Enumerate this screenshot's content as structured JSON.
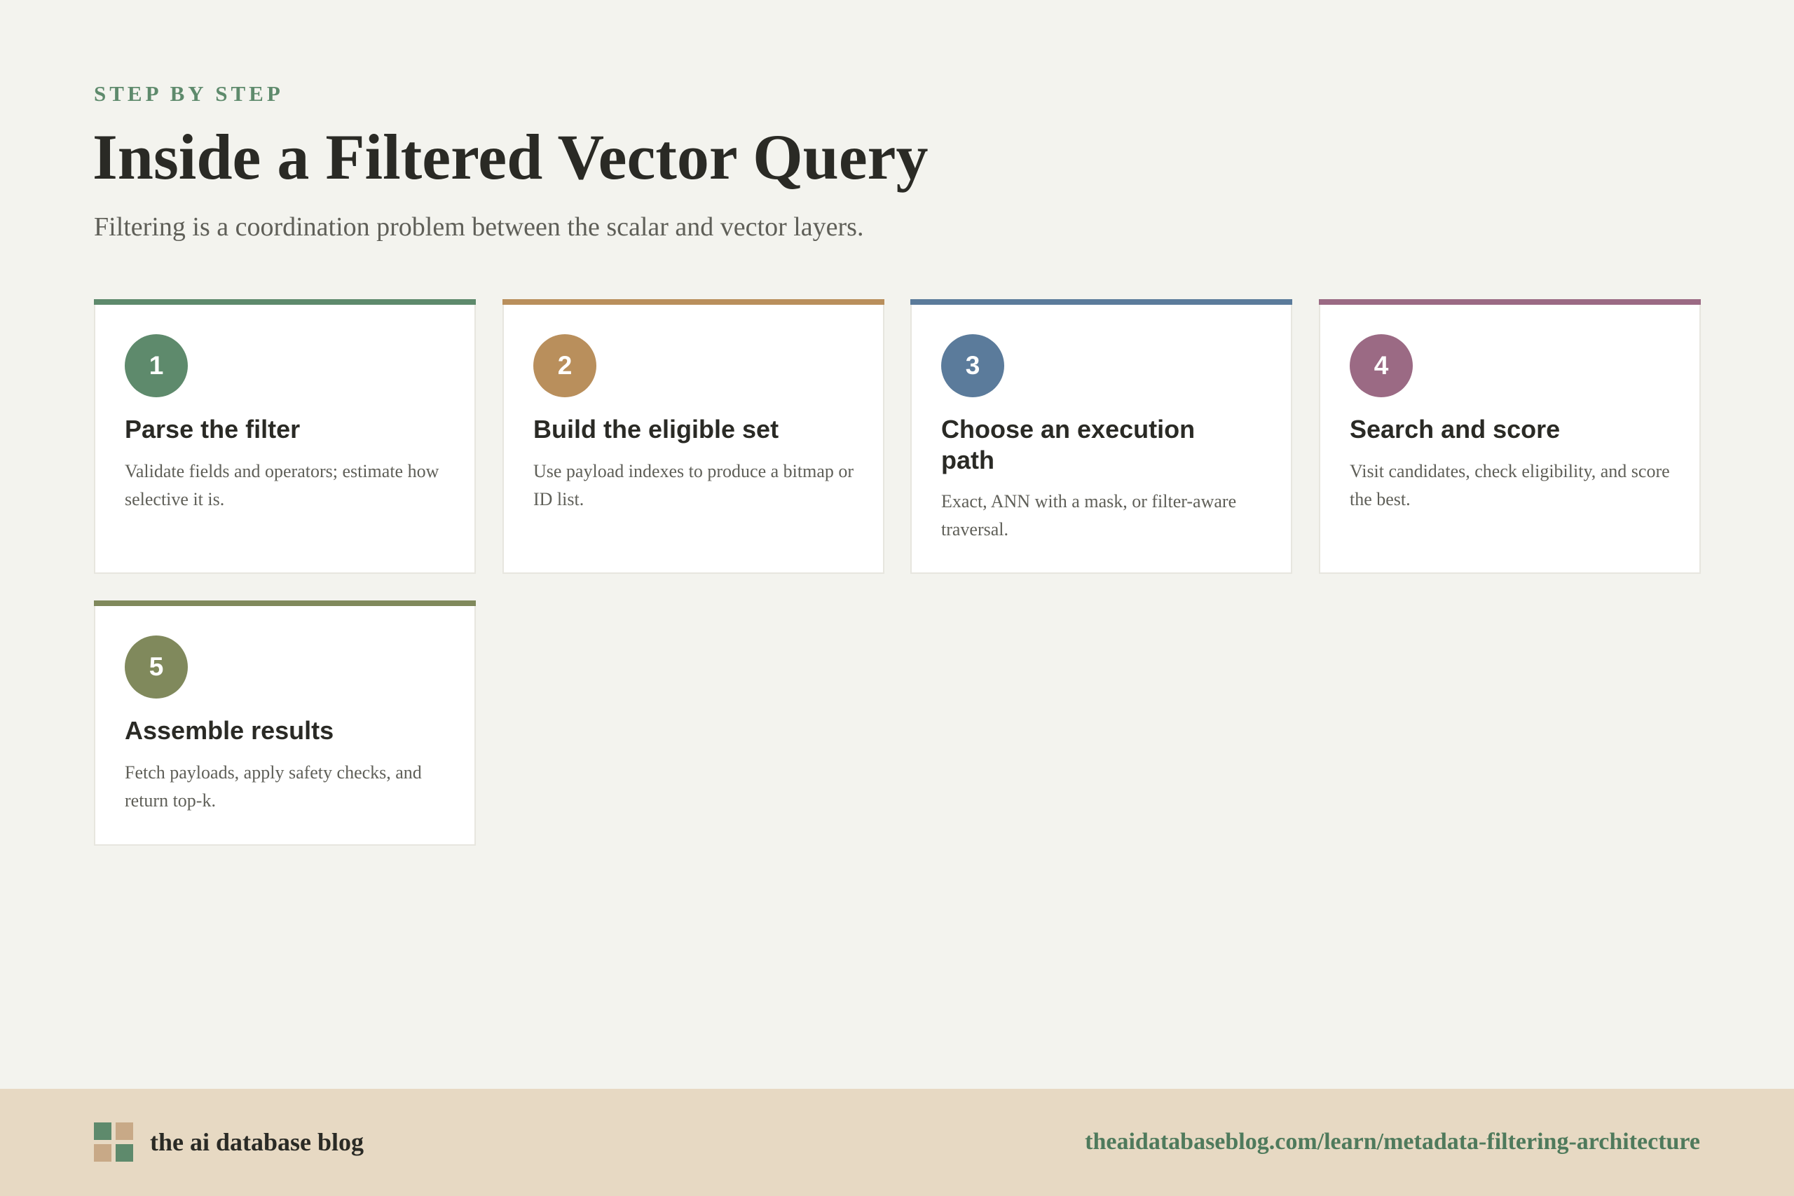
{
  "header": {
    "eyebrow": "STEP BY STEP",
    "title": "Inside a Filtered Vector Query",
    "subtitle": "Filtering is a coordination problem between the scalar and vector layers."
  },
  "steps": [
    {
      "number": "1",
      "title": "Parse the filter",
      "description": "Validate fields and operators; estimate how selective it is.",
      "color": "#5e8a6c"
    },
    {
      "number": "2",
      "title": "Build the eligible set",
      "description": "Use payload indexes to produce a bitmap or ID list.",
      "color": "#b98f5c"
    },
    {
      "number": "3",
      "title": "Choose an execution path",
      "description": "Exact, ANN with a mask, or filter-aware traversal.",
      "color": "#5b7b9b"
    },
    {
      "number": "4",
      "title": "Search and score",
      "description": "Visit candidates, check eligibility, and score the best.",
      "color": "#9b6a84"
    },
    {
      "number": "5",
      "title": "Assemble results",
      "description": "Fetch payloads, apply safety checks, and return top-k.",
      "color": "#80895c"
    }
  ],
  "footer": {
    "brand": "the ai database blog",
    "url": "theaidatabaseblog.com/learn/metadata-filtering-architecture",
    "logo_colors": [
      "#5e8a6c",
      "#c8a987",
      "#c8a987",
      "#5e8a6c"
    ]
  }
}
